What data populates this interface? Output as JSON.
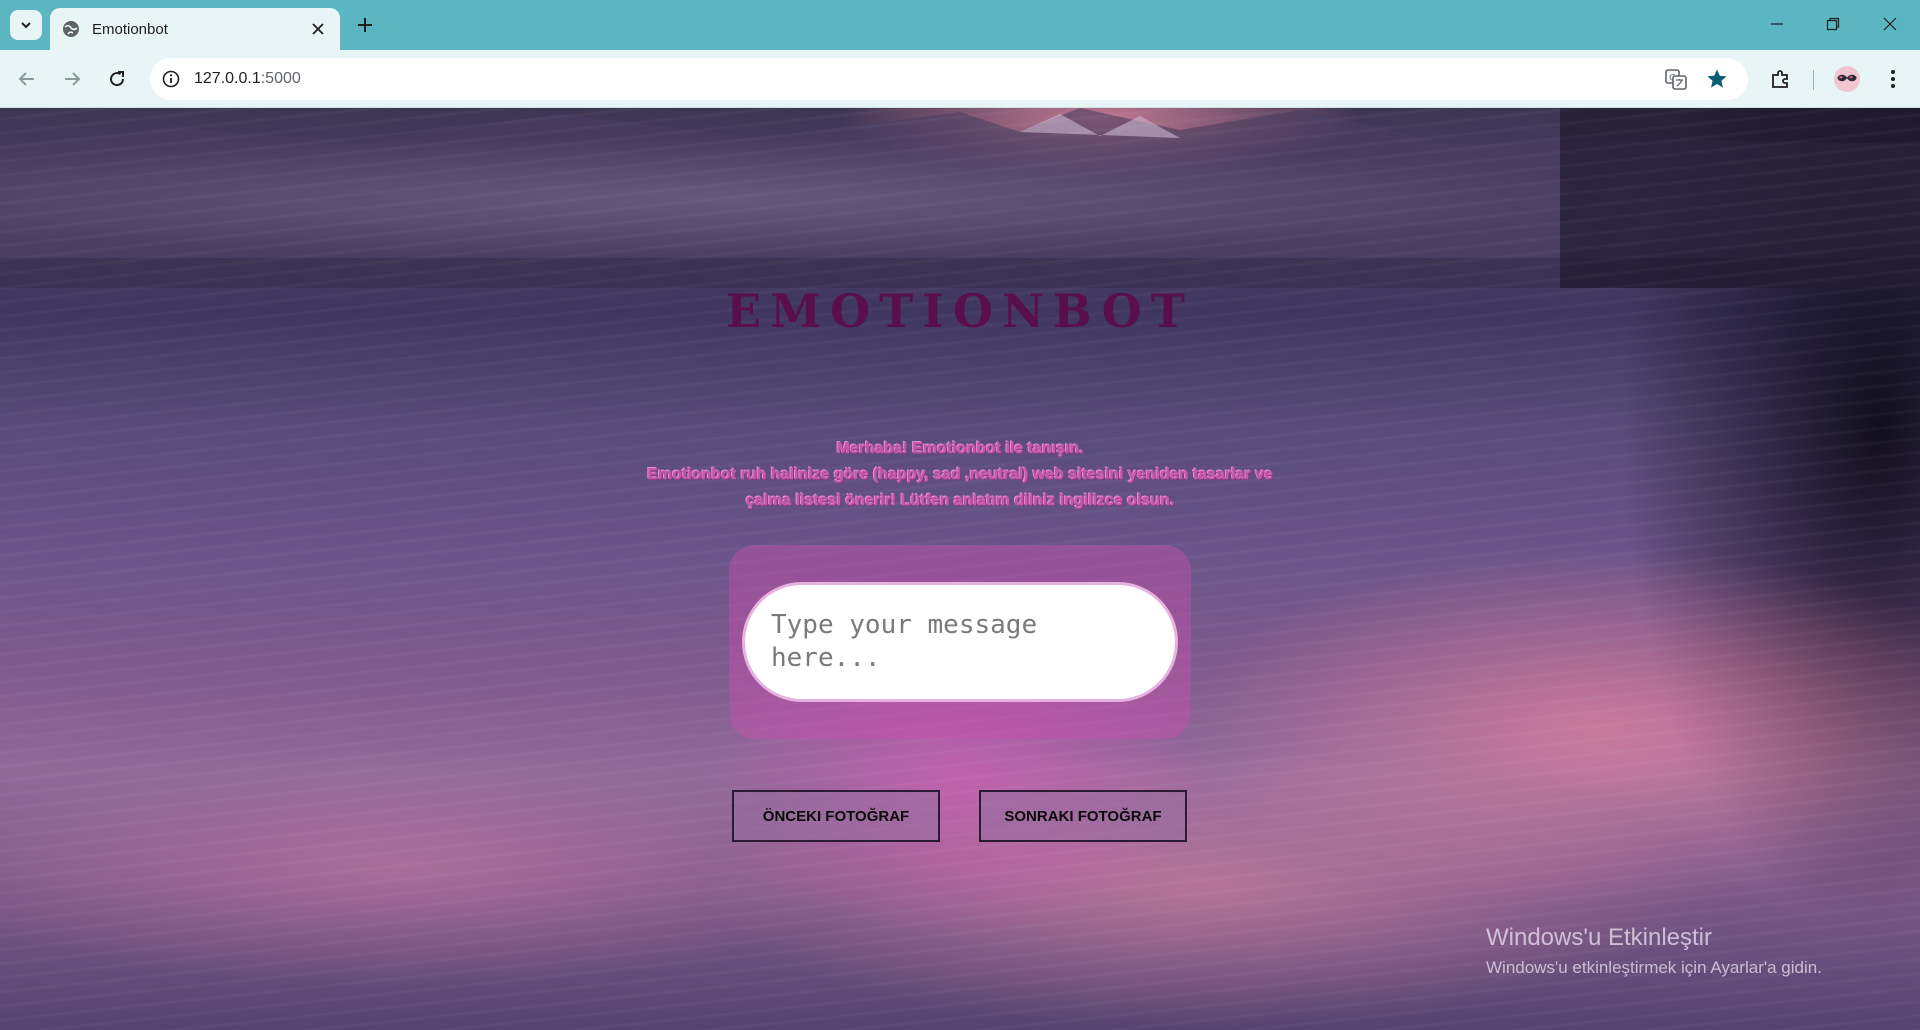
{
  "browser": {
    "tab_title": "Emotionbot",
    "url_host": "127.0.0.1",
    "url_port": ":5000"
  },
  "page": {
    "title": "EMOTIONBOT",
    "intro_line1": "Merhaba! Emotionbot ile tanışın.",
    "intro_line2": "Emotionbot ruh halinize göre (happy, sad ,neutral) web sitesini yeniden tasarlar ve",
    "intro_line3": "çalma listesi önerir! Lütfen anlatım dilniz ingilizce olsun.",
    "message_placeholder": "Type your message here...",
    "prev_photo_label": "ÖNCEKI FOTOĞRAF",
    "next_photo_label": "SONRAKI FOTOĞRAF"
  },
  "windows_watermark": {
    "title": "Windows'u Etkinleştir",
    "subtitle": "Windows'u etkinleştirmek için Ayarlar'a gidin."
  },
  "colors": {
    "tabstrip": "#5cb6c1",
    "toolbar": "#e7f5f7",
    "title": "#5a0f4d",
    "intro_text": "#c15aa6"
  }
}
